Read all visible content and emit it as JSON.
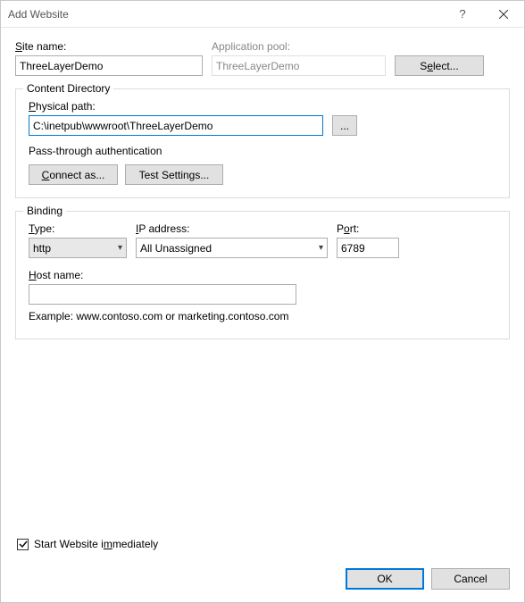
{
  "titlebar": {
    "title": "Add Website",
    "help": "?",
    "close": "×"
  },
  "site": {
    "site_name_label": "Site name:",
    "site_name_value": "ThreeLayerDemo",
    "app_pool_label": "Application pool:",
    "app_pool_value": "ThreeLayerDemo",
    "select_label": "Select..."
  },
  "content_dir": {
    "group_title": "Content Directory",
    "physical_path_label": "Physical path:",
    "physical_path_value": "C:\\inetpub\\wwwroot\\ThreeLayerDemo",
    "browse_label": "...",
    "passthrough_label": "Pass-through authentication",
    "connect_as_label": "Connect as...",
    "test_settings_label": "Test Settings..."
  },
  "binding": {
    "group_title": "Binding",
    "type_label": "Type:",
    "type_value": "http",
    "ip_label": "IP address:",
    "ip_value": "All Unassigned",
    "port_label": "Port:",
    "port_value": "6789",
    "host_label": "Host name:",
    "host_value": "",
    "example": "Example: www.contoso.com or marketing.contoso.com"
  },
  "start_immediately": {
    "label": "Start Website immediately",
    "checked": true
  },
  "footer": {
    "ok": "OK",
    "cancel": "Cancel"
  }
}
